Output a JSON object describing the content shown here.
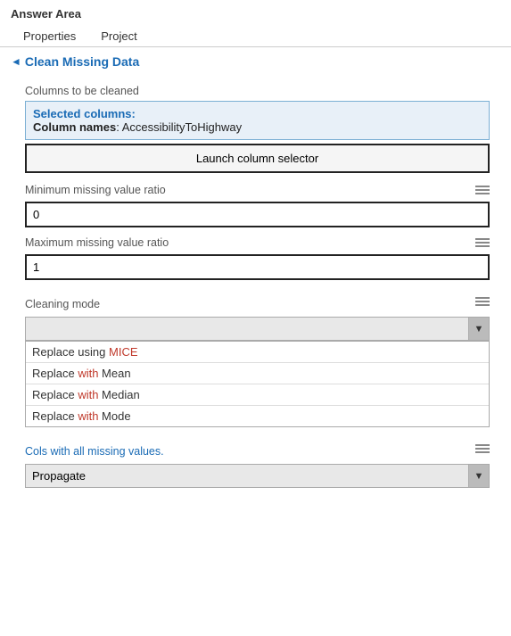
{
  "header": {
    "answer_area": "Answer Area",
    "tabs": [
      "Properties",
      "Project"
    ]
  },
  "section": {
    "title": "Clean Missing Data",
    "chevron": "◄"
  },
  "columns_to_clean": {
    "label": "Columns to be cleaned",
    "selected_title": "Selected columns:",
    "column_label": "Column names",
    "column_value": "AccessibilityToHighway",
    "launch_btn": "Launch column selector"
  },
  "min_missing": {
    "label": "Minimum missing value ratio",
    "value": "0"
  },
  "max_missing": {
    "label": "Maximum missing value ratio",
    "value": "1"
  },
  "cleaning_mode": {
    "label": "Cleaning mode",
    "selected": "",
    "options": [
      {
        "text": "Replace using MICE",
        "highlight": "MICE"
      },
      {
        "text": "Replace with Mean",
        "highlight": "with"
      },
      {
        "text": "Replace with Median",
        "highlight": "with"
      },
      {
        "text": "Replace with Mode",
        "highlight": "with"
      }
    ]
  },
  "cols_missing": {
    "label": "Cols with all missing values.",
    "selected": "Propagate"
  },
  "icons": {
    "chevron_down": "▼"
  }
}
